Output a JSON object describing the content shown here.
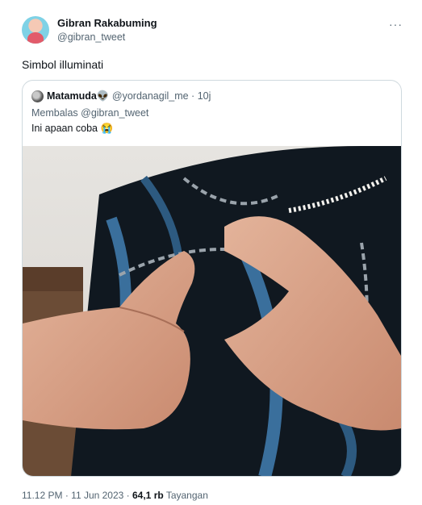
{
  "tweet": {
    "author_name": "Gibran Rakabuming",
    "author_handle": "@gibran_tweet",
    "more_icon": "more-horizontal-icon",
    "more_glyph": "···",
    "text": "Simbol illuminati",
    "time": "11.12 PM",
    "separator": " · ",
    "date": "11 Jun 2023",
    "views_separator": " · ",
    "views_count": "64,1 rb",
    "views_label": "Tayangan"
  },
  "quote": {
    "name": "Matamuda",
    "badge_emoji": "👽",
    "handle": "@yordanagil_me",
    "dot": " · ",
    "time": "10j",
    "reply_to": "Membalas @gibran_tweet",
    "text": "Ini apaan coba 😭"
  },
  "colors": {
    "text_primary": "#0f1419",
    "text_secondary": "#536471",
    "border": "#cfd9de"
  }
}
